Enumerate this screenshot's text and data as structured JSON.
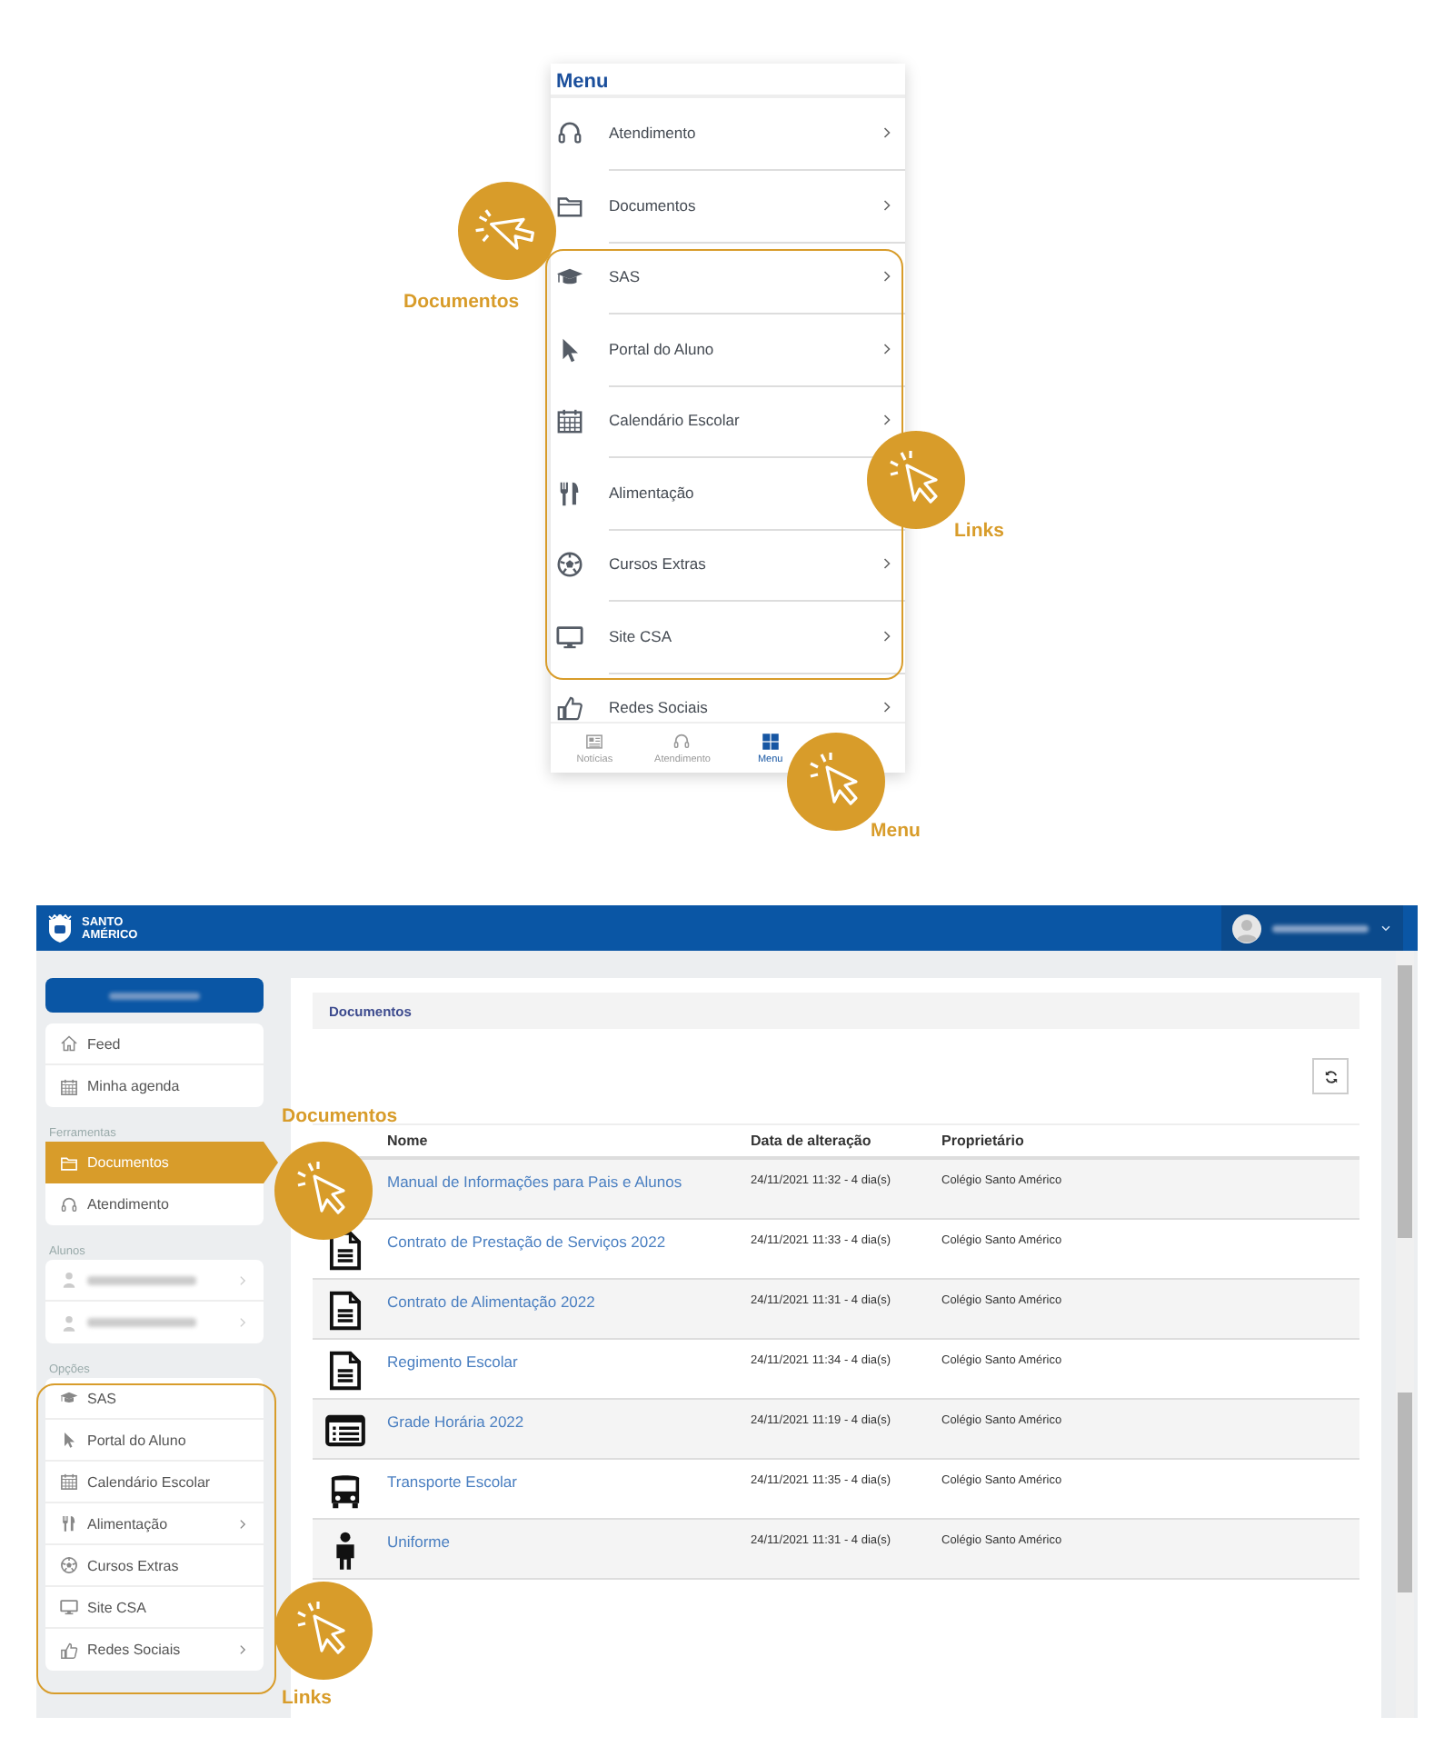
{
  "phone_menu": {
    "title": "Menu",
    "items": [
      {
        "label": "Atendimento",
        "chevron": true
      },
      {
        "label": "Documentos",
        "chevron": true
      },
      {
        "label": "SAS",
        "chevron": true
      },
      {
        "label": "Portal do Aluno",
        "chevron": true
      },
      {
        "label": "Calendário Escolar",
        "chevron": true
      },
      {
        "label": "Alimentação",
        "chevron": false
      },
      {
        "label": "Cursos Extras",
        "chevron": true
      },
      {
        "label": "Site CSA",
        "chevron": true
      },
      {
        "label": "Redes Sociais",
        "chevron": true
      }
    ],
    "tabs": [
      {
        "label": "Notícias",
        "selected": false
      },
      {
        "label": "Atendimento",
        "selected": false
      },
      {
        "label": "Menu",
        "selected": true
      }
    ]
  },
  "web_app": {
    "brand": [
      "SANTO",
      "AMÉRICO"
    ],
    "sidebar": {
      "quick_links": [
        {
          "label": "Feed",
          "selected": false
        },
        {
          "label": "Minha agenda",
          "selected": false
        }
      ],
      "tools_heading": "Ferramentas",
      "tools": [
        {
          "label": "Documentos",
          "selected": true
        },
        {
          "label": "Atendimento",
          "selected": false
        }
      ],
      "students_heading": "Alunos",
      "students": [
        {
          "chevron": true
        },
        {
          "chevron": true
        }
      ],
      "options_heading": "Opções",
      "options": [
        {
          "label": "SAS",
          "chevron": false
        },
        {
          "label": "Portal do Aluno",
          "chevron": false
        },
        {
          "label": "Calendário Escolar",
          "chevron": false
        },
        {
          "label": "Alimentação",
          "chevron": true
        },
        {
          "label": "Cursos Extras",
          "chevron": false
        },
        {
          "label": "Site CSA",
          "chevron": false
        },
        {
          "label": "Redes Sociais",
          "chevron": true
        }
      ]
    },
    "breadcrumb": "Documentos",
    "table": {
      "columns": [
        "Nome",
        "Data de alteração",
        "Proprietário"
      ],
      "rows": [
        {
          "name": "Manual de Informações para Pais e Alunos",
          "modified": "24/11/2021 11:32 - 4 dia(s)",
          "owner": "Colégio Santo Américo"
        },
        {
          "name": "Contrato de Prestação de Serviços 2022",
          "modified": "24/11/2021 11:33 - 4 dia(s)",
          "owner": "Colégio Santo Américo"
        },
        {
          "name": "Contrato de Alimentação 2022",
          "modified": "24/11/2021 11:31 - 4 dia(s)",
          "owner": "Colégio Santo Américo"
        },
        {
          "name": "Regimento Escolar",
          "modified": "24/11/2021 11:34 - 4 dia(s)",
          "owner": "Colégio Santo Américo"
        },
        {
          "name": "Grade Horária 2022",
          "modified": "24/11/2021 11:19 - 4 dia(s)",
          "owner": "Colégio Santo Américo"
        },
        {
          "name": "Transporte Escolar",
          "modified": "24/11/2021 11:35 - 4 dia(s)",
          "owner": "Colégio Santo Américo"
        },
        {
          "name": "Uniforme",
          "modified": "24/11/2021 11:31 - 4 dia(s)",
          "owner": "Colégio Santo Américo"
        }
      ]
    }
  },
  "callouts": [
    {
      "label": "Documentos"
    },
    {
      "label": "Links"
    },
    {
      "label": "Menu"
    },
    {
      "label": "Documentos"
    },
    {
      "label": "Links"
    }
  ]
}
